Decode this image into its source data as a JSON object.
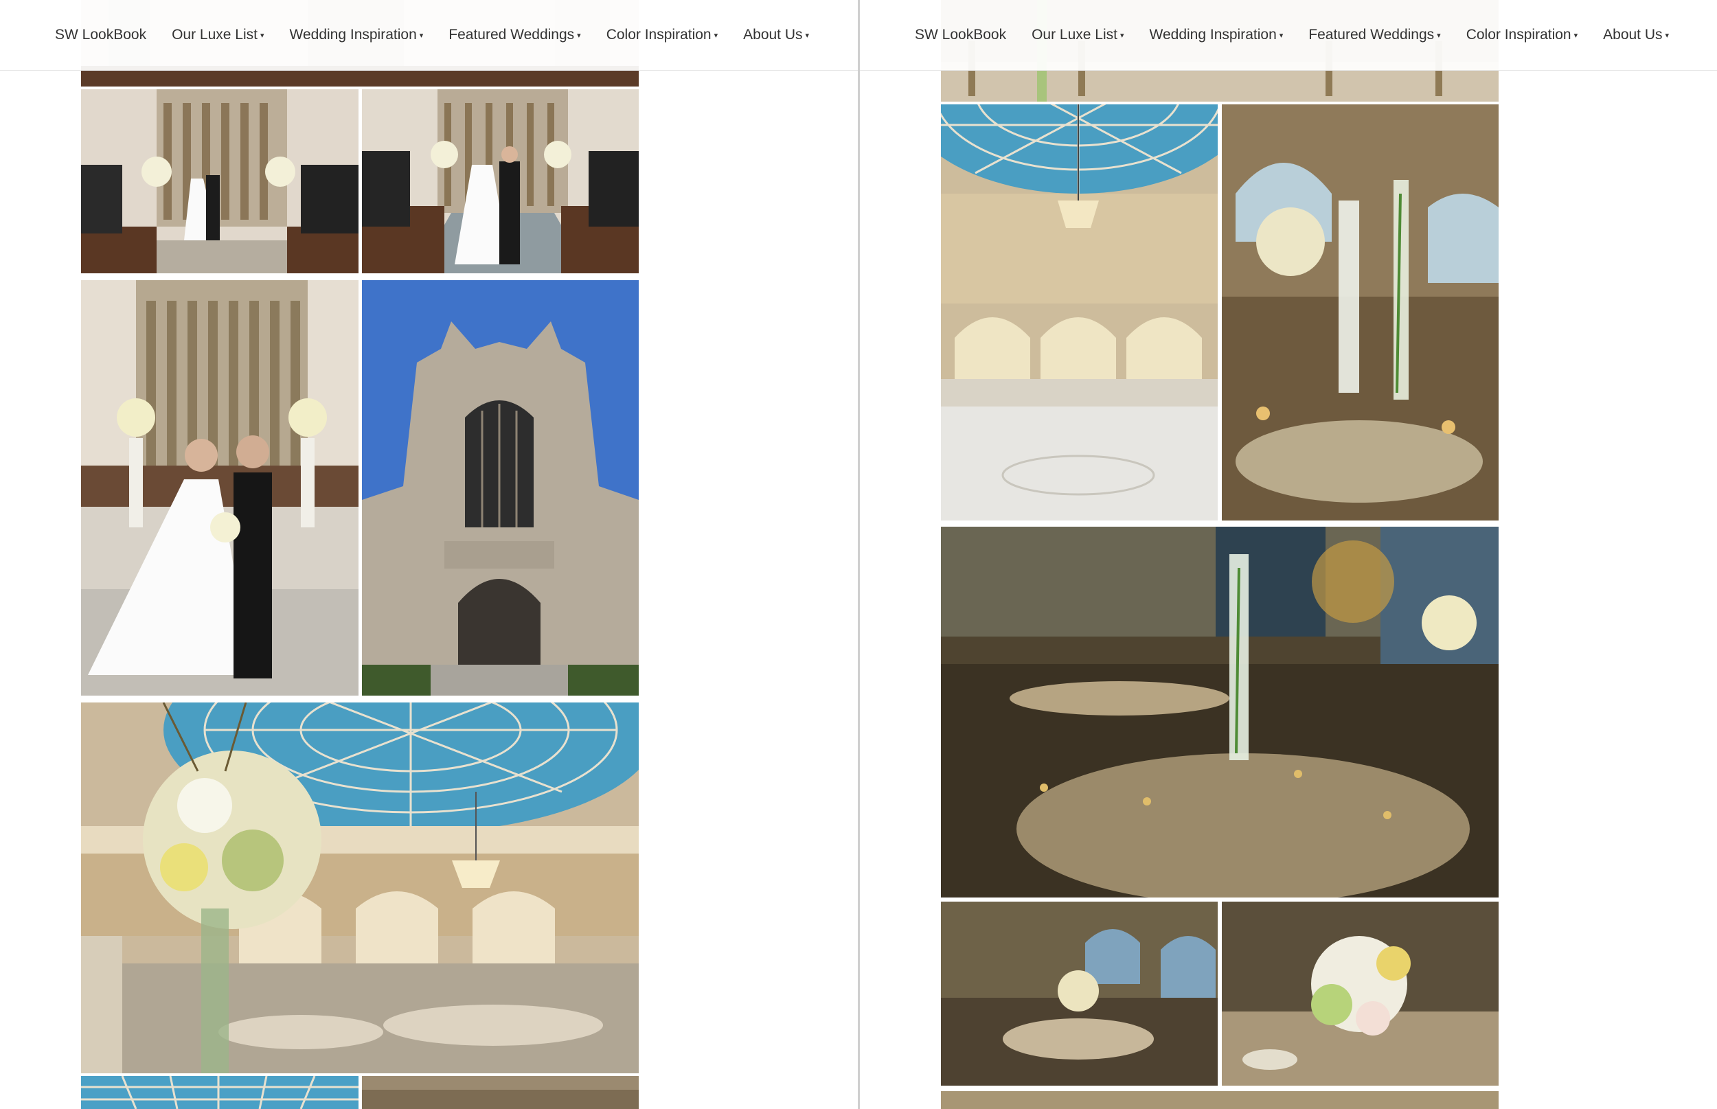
{
  "pages": [
    {
      "nav": [
        {
          "label": "SW LookBook",
          "dropdown": false
        },
        {
          "label": "Our Luxe List",
          "dropdown": true
        },
        {
          "label": "Wedding Inspiration",
          "dropdown": true
        },
        {
          "label": "Featured Weddings",
          "dropdown": true
        },
        {
          "label": "Color Inspiration",
          "dropdown": true
        },
        {
          "label": "About Us",
          "dropdown": true
        }
      ]
    },
    {
      "nav": [
        {
          "label": "SW LookBook",
          "dropdown": false
        },
        {
          "label": "Our Luxe List",
          "dropdown": true
        },
        {
          "label": "Wedding Inspiration",
          "dropdown": true
        },
        {
          "label": "Featured Weddings",
          "dropdown": true
        },
        {
          "label": "Color Inspiration",
          "dropdown": true
        },
        {
          "label": "About Us",
          "dropdown": true
        }
      ]
    }
  ],
  "caret_glyph": "▾",
  "colors": {
    "nav_text": "#333333",
    "dome_blue": "#4a9ec2",
    "sky_blue": "#3d6ec9",
    "stone": "#b9ae9b",
    "gold": "#c49a4c"
  }
}
